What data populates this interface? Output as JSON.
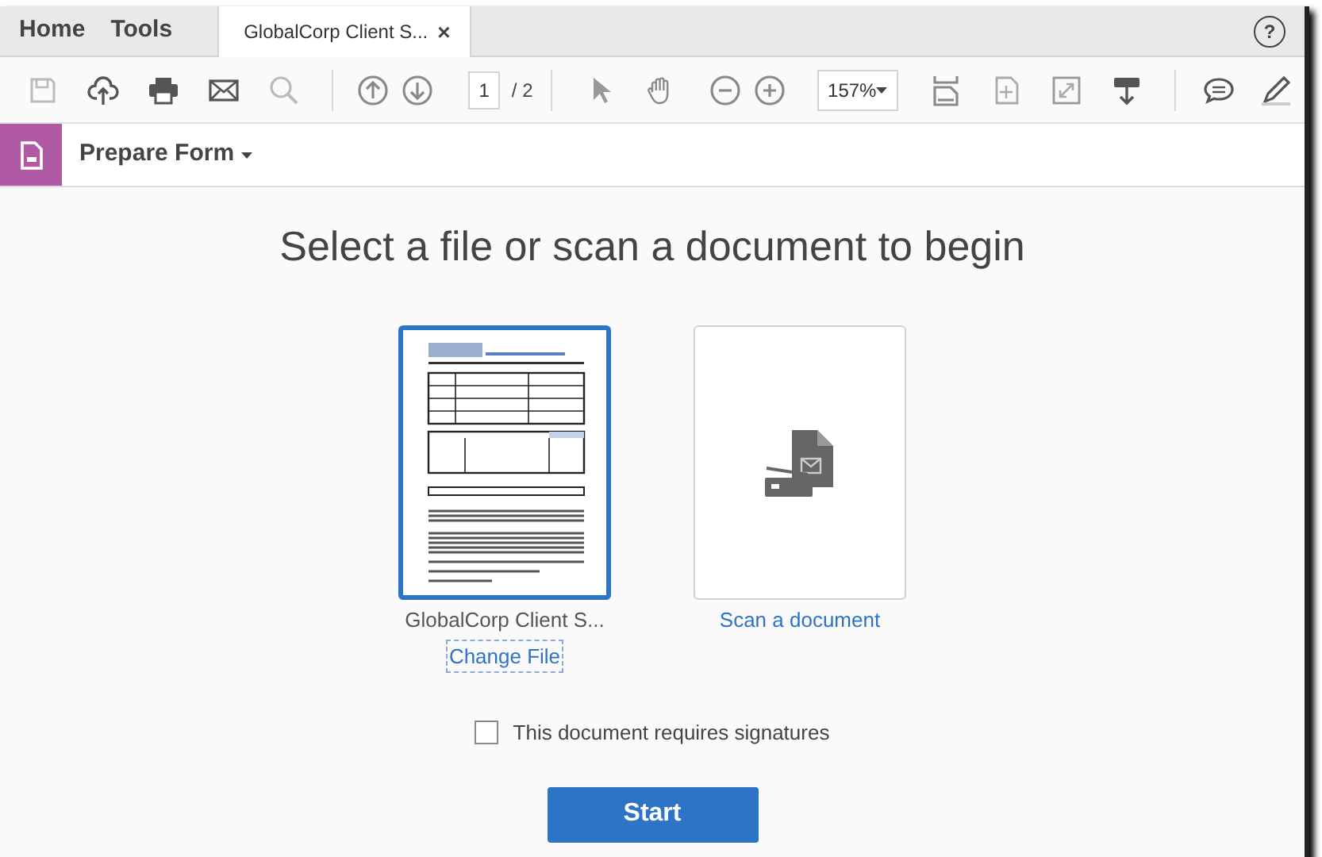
{
  "tabs": [
    {
      "label": "Home",
      "selected": false,
      "kind": "nav"
    },
    {
      "label": "Tools",
      "selected": false,
      "kind": "nav"
    },
    {
      "label": "GlobalCorp Client S...",
      "selected": true,
      "kind": "document",
      "close": "×"
    }
  ],
  "help": "?",
  "toolbar": {
    "page": "1",
    "page_total": "/ 2",
    "zoom": "157%"
  },
  "tool_bar": {
    "title": "Prepare Form"
  },
  "heading": "Select a file or scan a document to begin",
  "sources": [
    {
      "kind": "file",
      "label": "GlobalCorp Client S...",
      "action": "Change File",
      "selected": true
    },
    {
      "kind": "scan",
      "label": "Scan a document",
      "selected": false
    }
  ],
  "signatures": {
    "label": "This document requires signatures",
    "checked": false
  },
  "start": "Start"
}
